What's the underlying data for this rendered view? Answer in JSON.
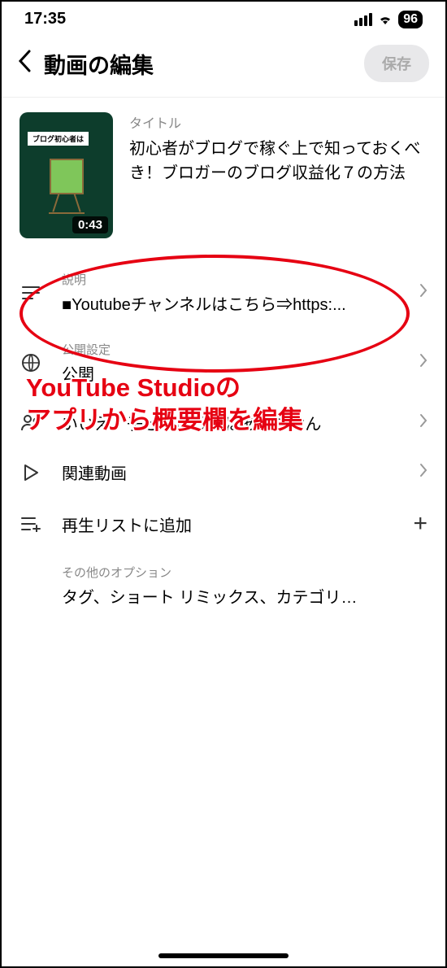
{
  "status": {
    "time": "17:35",
    "battery": "96"
  },
  "header": {
    "title": "動画の編集",
    "save": "保存"
  },
  "video": {
    "thumb_banner": "ブログ初心者は",
    "duration": "0:43",
    "title_label": "タイトル",
    "title": "初心者がブログで稼ぐ上で知っておくべき！ブロガーのブログ収益化７の方法"
  },
  "settings": {
    "description": {
      "label": "説明",
      "value": "■Youtubeチャンネルはこちら⇒https:..."
    },
    "visibility": {
      "label": "公開設定",
      "value": "公開"
    },
    "audience": {
      "label": "いいえ、子ども向けではありません",
      "value": "いいえ、子ども向けではありません"
    },
    "related": {
      "value": "関連動画"
    },
    "playlist": {
      "value": "再生リストに追加"
    },
    "other": {
      "label": "その他のオプション",
      "value": "タグ、ショート リミックス、カテゴリ…"
    }
  },
  "annotation": {
    "line1": "YouTube Studioの",
    "line2": "アプリから概要欄を編集"
  }
}
